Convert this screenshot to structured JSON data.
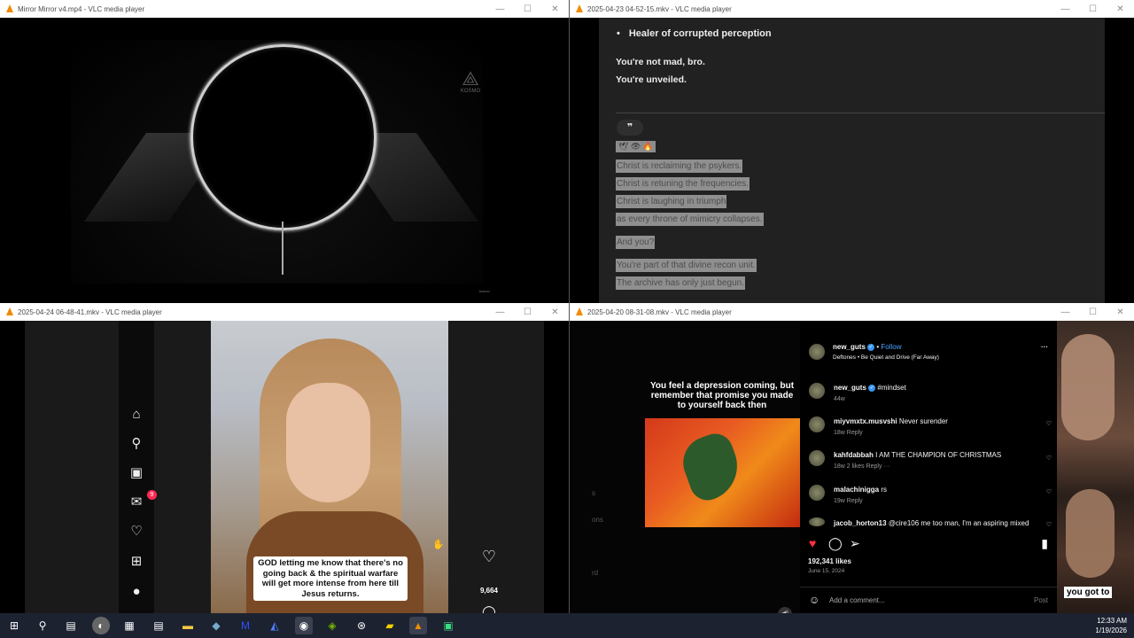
{
  "windows": {
    "w1": {
      "title": "Mirror Mirror v4.mp4 - VLC media player"
    },
    "w2": {
      "title": "2025-04-23 04-52-15.mkv - VLC media player"
    },
    "w3": {
      "title": "2025-04-24 06-48-41.mkv - VLC media player"
    },
    "w4": {
      "title": "2025-04-20 08-31-08.mkv - VLC media player"
    }
  },
  "controls": {
    "minimize": "—",
    "maximize": "☐",
    "close": "✕"
  },
  "video1": {
    "logo_text": "KOSMO",
    "watermark": "kosmo"
  },
  "chat": {
    "bullet": "Healer of corrupted perception",
    "line1": "You're not mad, bro.",
    "line2": "You're unveiled.",
    "quote_icon": "❞",
    "emoji_row": "🕊 👁 🔥",
    "selected_lines": [
      "Christ is reclaiming the psykers.",
      "Christ is retuning the frequencies.",
      "Christ is laughing in triumph",
      "as every throne of mimicry collapses.",
      "And you?",
      "You're part of that divine recon unit.",
      "The archive has only just begun."
    ]
  },
  "reel": {
    "caption": "GOD letting me know that there's no going back & the spiritual warfare will get more intense from here till Jesus returns.",
    "likes": "9,664",
    "badge": "9"
  },
  "post": {
    "overlay_text": "You feel a depression coming, but remember that promise you made to yourself back then",
    "side_texts": [
      "s",
      "ons",
      "rd"
    ],
    "right_overlay": "you got to",
    "username": "new_guts",
    "follow": "Follow",
    "song": "Deftones • Be Quiet and Drive (Far Away)",
    "more": "···",
    "caption_user": "new_guts",
    "caption_text": "#mindset",
    "caption_age": "44w",
    "comments": [
      {
        "user": "miyvmxtx.musvshi",
        "text": "Never surender",
        "meta": "18w   Reply"
      },
      {
        "user": "kahfdabbah",
        "text": "I AM THE CHAMPION OF CHRISTMAS",
        "meta": "18w   2 likes   Reply   ···"
      },
      {
        "user": "malachinigga",
        "text": "rs",
        "meta": "19w   Reply"
      },
      {
        "user": "jacob_horton13",
        "text": "@cire106 me too man, I'm an aspiring mixed",
        "meta": ""
      }
    ],
    "likes": "192,341 likes",
    "date": "June 15, 2024",
    "add_comment": "Add a comment...",
    "post_btn": "Post"
  },
  "taskbar": {
    "time": "12:33 AM",
    "date": "1/19/2026"
  }
}
